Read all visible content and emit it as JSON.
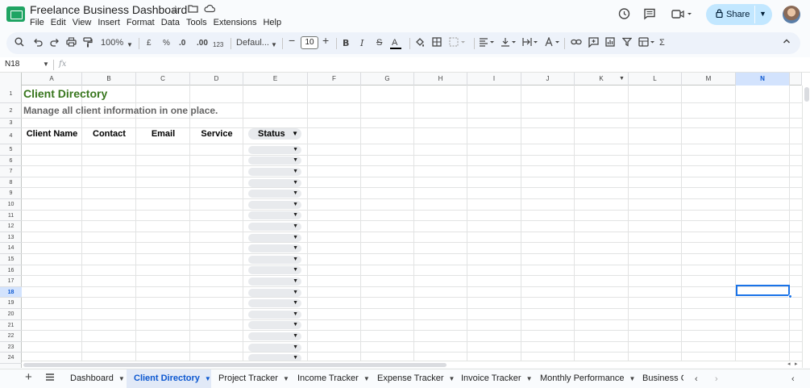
{
  "app": {
    "title": "Freelance Business Dashboard",
    "menus": [
      "File",
      "Edit",
      "View",
      "Insert",
      "Format",
      "Data",
      "Tools",
      "Extensions",
      "Help"
    ],
    "share_label": "Share"
  },
  "toolbar": {
    "zoom": "100%",
    "currency": "£",
    "percent": "%",
    "dec_decrease": ".0",
    "dec_increase": ".00",
    "number_format": "123",
    "font": "Defaul...",
    "font_size": "10",
    "bold": "B",
    "italic": "I",
    "strike": "S",
    "text_color": "A",
    "sum": "Σ"
  },
  "formula_bar": {
    "cell_ref": "N18",
    "fx": "fx",
    "value": ""
  },
  "grid": {
    "columns": [
      "A",
      "B",
      "C",
      "D",
      "E",
      "F",
      "G",
      "H",
      "I",
      "J",
      "K",
      "L",
      "M",
      "N"
    ],
    "rows": [
      "1",
      "2",
      "3",
      "4",
      "5",
      "6",
      "7",
      "8",
      "9",
      "10",
      "11",
      "12",
      "13",
      "14",
      "15",
      "16",
      "17",
      "18",
      "19",
      "20",
      "21",
      "22",
      "23",
      "24"
    ],
    "selected_cell": "N18",
    "title": "Client Directory",
    "subtitle": "Manage all client information in one place.",
    "headers": [
      "Client Name",
      "Contact",
      "Email",
      "Service",
      "Status"
    ],
    "accent_title_color": "#38761d",
    "subtitle_color": "#666666"
  },
  "sheets": [
    {
      "name": "Dashboard",
      "active": false
    },
    {
      "name": "Client Directory",
      "active": true
    },
    {
      "name": "Project Tracker",
      "active": false
    },
    {
      "name": "Income Tracker",
      "active": false
    },
    {
      "name": "Expense Tracker",
      "active": false
    },
    {
      "name": "Invoice Tracker",
      "active": false
    },
    {
      "name": "Monthly Performance",
      "active": false
    },
    {
      "name": "Business Go",
      "active": false
    }
  ],
  "icons": {
    "star": "star-icon",
    "folder": "move-folder-icon",
    "cloud": "cloud-status-icon",
    "history": "version-history-icon",
    "comment": "comments-icon",
    "meet": "video-call-icon",
    "lock": "lock-icon"
  }
}
